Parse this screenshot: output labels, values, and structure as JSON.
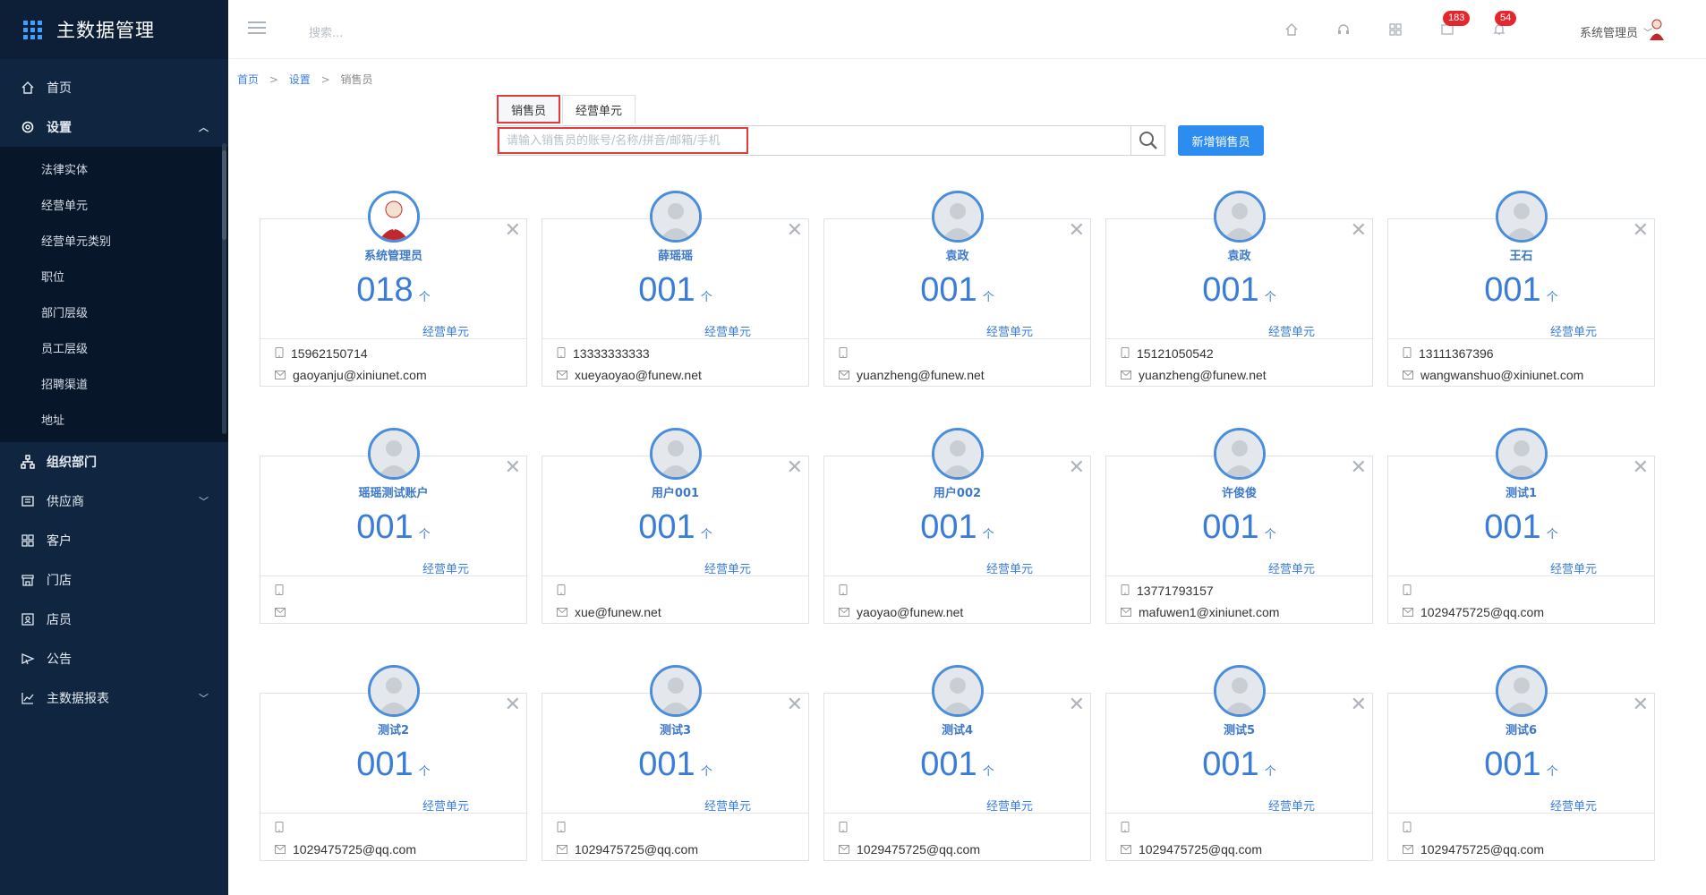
{
  "app": {
    "title": "主数据管理"
  },
  "sidebar": {
    "items": [
      {
        "key": "home",
        "label": "首页",
        "icon": "home-icon"
      },
      {
        "key": "settings",
        "label": "设置",
        "icon": "gear-icon",
        "expanded": true,
        "children": [
          "法律实体",
          "经营单元",
          "经营单元类别",
          "职位",
          "部门层级",
          "员工层级",
          "招聘渠道",
          "地址"
        ]
      },
      {
        "key": "org",
        "label": "组织部门",
        "icon": "org-icon"
      },
      {
        "key": "supplier",
        "label": "供应商",
        "icon": "supplier-icon",
        "has_children": true
      },
      {
        "key": "customer",
        "label": "客户",
        "icon": "customer-icon"
      },
      {
        "key": "store",
        "label": "门店",
        "icon": "store-icon"
      },
      {
        "key": "clerk",
        "label": "店员",
        "icon": "clerk-icon"
      },
      {
        "key": "notice",
        "label": "公告",
        "icon": "notice-icon"
      },
      {
        "key": "report",
        "label": "主数据报表",
        "icon": "chart-icon",
        "has_children": true
      }
    ]
  },
  "topbar": {
    "search_placeholder": "搜索...",
    "badges": {
      "messages": "183",
      "notifications": "54"
    },
    "user": "系统管理员"
  },
  "breadcrumb": {
    "home": "首页",
    "settings": "设置",
    "current": "销售员"
  },
  "tabs": [
    {
      "label": "销售员",
      "active": true
    },
    {
      "label": "经营单元",
      "active": false
    }
  ],
  "search": {
    "placeholder": "请输入销售员的账号/名称/拼音/邮箱/手机",
    "add_label": "新增销售员"
  },
  "cards": [
    {
      "name": "系统管理员",
      "count": "018",
      "unit": "个",
      "unit_label": "经营单元",
      "phone": "15962150714",
      "email": "gaoyanju@xiniunet.com",
      "avatar": "admin"
    },
    {
      "name": "薛瑶瑶",
      "count": "001",
      "unit": "个",
      "unit_label": "经营单元",
      "phone": "13333333333",
      "email": "xueyaoyao@funew.net",
      "avatar": "default"
    },
    {
      "name": "袁政",
      "count": "001",
      "unit": "个",
      "unit_label": "经营单元",
      "phone": "",
      "email": "yuanzheng@funew.net",
      "avatar": "default"
    },
    {
      "name": "袁政",
      "count": "001",
      "unit": "个",
      "unit_label": "经营单元",
      "phone": "15121050542",
      "email": "yuanzheng@funew.net",
      "avatar": "default"
    },
    {
      "name": "王石",
      "count": "001",
      "unit": "个",
      "unit_label": "经营单元",
      "phone": "13111367396",
      "email": "wangwanshuo@xiniunet.com",
      "avatar": "default"
    },
    {
      "name": "瑶瑶测试账户",
      "count": "001",
      "unit": "个",
      "unit_label": "经营单元",
      "phone": "",
      "email": "",
      "avatar": "default"
    },
    {
      "name": "用户001",
      "count": "001",
      "unit": "个",
      "unit_label": "经营单元",
      "phone": "",
      "email": "xue@funew.net",
      "avatar": "default"
    },
    {
      "name": "用户002",
      "count": "001",
      "unit": "个",
      "unit_label": "经营单元",
      "phone": "",
      "email": "yaoyao@funew.net",
      "avatar": "default"
    },
    {
      "name": "许俊俊",
      "count": "001",
      "unit": "个",
      "unit_label": "经营单元",
      "phone": "13771793157",
      "email": "mafuwen1@xiniunet.com",
      "avatar": "default"
    },
    {
      "name": "测试1",
      "count": "001",
      "unit": "个",
      "unit_label": "经营单元",
      "phone": "",
      "email": "1029475725@qq.com",
      "avatar": "default"
    },
    {
      "name": "测试2",
      "count": "001",
      "unit": "个",
      "unit_label": "经营单元",
      "phone": "",
      "email": "1029475725@qq.com",
      "avatar": "default"
    },
    {
      "name": "测试3",
      "count": "001",
      "unit": "个",
      "unit_label": "经营单元",
      "phone": "",
      "email": "1029475725@qq.com",
      "avatar": "default"
    },
    {
      "name": "测试4",
      "count": "001",
      "unit": "个",
      "unit_label": "经营单元",
      "phone": "",
      "email": "1029475725@qq.com",
      "avatar": "default"
    },
    {
      "name": "测试5",
      "count": "001",
      "unit": "个",
      "unit_label": "经营单元",
      "phone": "",
      "email": "1029475725@qq.com",
      "avatar": "default"
    },
    {
      "name": "测试6",
      "count": "001",
      "unit": "个",
      "unit_label": "经营单元",
      "phone": "",
      "email": "1029475725@qq.com",
      "avatar": "default"
    }
  ],
  "colors": {
    "sidebar_bg": "#0f2540",
    "accent": "#2d8cf0",
    "highlight": "#e53b3b",
    "badge": "#e6262e"
  }
}
